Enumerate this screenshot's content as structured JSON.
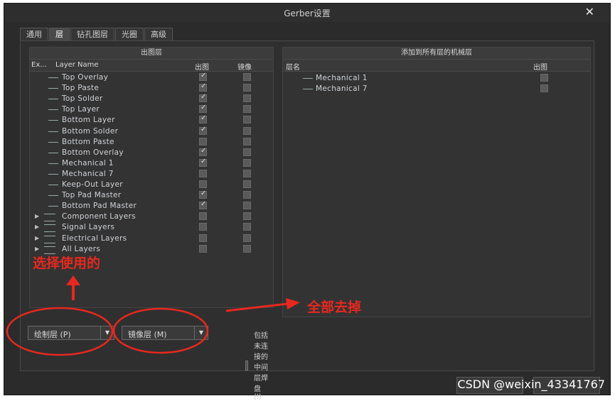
{
  "window": {
    "title": "Gerber设置",
    "close_glyph": "✕"
  },
  "tabs": [
    {
      "label": "通用",
      "active": false
    },
    {
      "label": "层",
      "active": true
    },
    {
      "label": "钻孔图层",
      "active": false
    },
    {
      "label": "光圈",
      "active": false
    },
    {
      "label": "高级",
      "active": false
    }
  ],
  "left_panel": {
    "header": "出图层",
    "columns": {
      "ex": "Ex...",
      "name": "Layer Name",
      "plot": "出图",
      "mirror": "镜像"
    },
    "layers": [
      {
        "name": "Top Overlay",
        "plot": true,
        "mirror": false,
        "group": false
      },
      {
        "name": "Top Paste",
        "plot": true,
        "mirror": false,
        "group": false
      },
      {
        "name": "Top Solder",
        "plot": true,
        "mirror": false,
        "group": false
      },
      {
        "name": "Top Layer",
        "plot": true,
        "mirror": false,
        "group": false
      },
      {
        "name": "Bottom Layer",
        "plot": true,
        "mirror": false,
        "group": false
      },
      {
        "name": "Bottom Solder",
        "plot": true,
        "mirror": false,
        "group": false
      },
      {
        "name": "Bottom Paste",
        "plot": false,
        "mirror": false,
        "group": false
      },
      {
        "name": "Bottom Overlay",
        "plot": true,
        "mirror": false,
        "group": false
      },
      {
        "name": "Mechanical 1",
        "plot": true,
        "mirror": false,
        "group": false
      },
      {
        "name": "Mechanical 7",
        "plot": false,
        "mirror": false,
        "group": false
      },
      {
        "name": "Keep-Out Layer",
        "plot": false,
        "mirror": false,
        "group": false
      },
      {
        "name": "Top Pad Master",
        "plot": true,
        "mirror": false,
        "group": false
      },
      {
        "name": "Bottom Pad Master",
        "plot": true,
        "mirror": false,
        "group": false
      },
      {
        "name": "Component Layers",
        "plot": false,
        "mirror": false,
        "group": true
      },
      {
        "name": "Signal Layers",
        "plot": false,
        "mirror": false,
        "group": true
      },
      {
        "name": "Electrical Layers",
        "plot": false,
        "mirror": false,
        "group": true
      },
      {
        "name": "All Layers",
        "plot": false,
        "mirror": false,
        "group": true
      }
    ]
  },
  "right_panel": {
    "header": "添加到所有层的机械层",
    "columns": {
      "name": "层名",
      "plot": "出图"
    },
    "layers": [
      {
        "name": "Mechanical 1",
        "plot": false
      },
      {
        "name": "Mechanical 7",
        "plot": false
      }
    ]
  },
  "bottom": {
    "plot_combo": "绘制层 (P)",
    "mirror_combo": "镜像层 (M)",
    "include_unconnected": "包括未连接的中间层焊盘 (I)",
    "include_checked": false
  },
  "annotations": {
    "select_use": "选择使用的",
    "remove_all": "全部去掉",
    "color": "#e8281e"
  },
  "watermark": "CSDN @weixin_43341767"
}
